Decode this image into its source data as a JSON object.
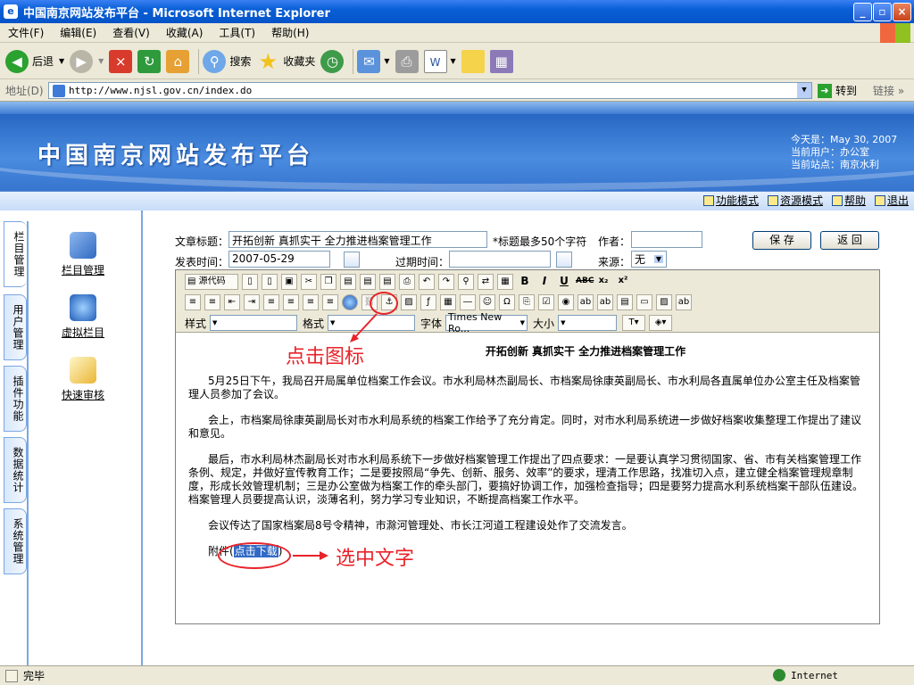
{
  "window": {
    "title": "中国南京网站发布平台 - Microsoft Internet Explorer"
  },
  "menu": [
    "文件(F)",
    "编辑(E)",
    "查看(V)",
    "收藏(A)",
    "工具(T)",
    "帮助(H)"
  ],
  "toolbar": {
    "back": "后退",
    "search": "搜索",
    "favorites": "收藏夹"
  },
  "address": {
    "label": "地址(D)",
    "url": "http://www.njsl.gov.cn/index.do",
    "go": "转到",
    "links": "链接"
  },
  "site": {
    "title": "中国南京网站发布平台",
    "today_label": "今天是：May 30, 2007",
    "user_label": "当前用户：办公室",
    "station_label": "当前站点：南京水利",
    "nav": [
      "功能模式",
      "资源模式",
      "帮助",
      "退出"
    ]
  },
  "sidebar": {
    "tabs": [
      "栏目管理",
      "用户管理",
      "插件功能",
      "数据统计",
      "系统管理"
    ],
    "items": [
      "栏目管理",
      "虚拟栏目",
      "快速审核"
    ]
  },
  "form": {
    "title_label": "文章标题：",
    "title_value": "开拓创新 真抓实干 全力推进档案管理工作",
    "title_hint": "*标题最多50个字符",
    "author_label": "作者：",
    "author_value": "",
    "pubdate_label": "发表时间：",
    "pubdate_value": "2007-05-29",
    "expire_label": "过期时间：",
    "expire_value": "",
    "source_label": "来源：",
    "source_value": "无",
    "save": "保 存",
    "back": "返 回"
  },
  "editor_toolbar": {
    "source_code": "源代码",
    "style_label": "样式",
    "format_label": "格式",
    "font_label": "字体",
    "font_value": "Times New Ro...",
    "size_label": "大小"
  },
  "document": {
    "title": "开拓创新 真抓实干 全力推进档案管理工作",
    "paragraphs": [
      "5月25日下午，我局召开局属单位档案工作会议。市水利局林杰副局长、市档案局徐康英副局长、市水利局各直属单位办公室主任及档案管理人员参加了会议。",
      "会上，市档案局徐康英副局长对市水利局系统的档案工作给予了充分肯定。同时，对市水利局系统进一步做好档案收集整理工作提出了建议和意见。",
      "最后，市水利局林杰副局长对市水利局系统下一步做好档案管理工作提出了四点要求：一是要认真学习贯彻国家、省、市有关档案管理工作条例、规定，并做好宣传教育工作；二是要按照局“争先、创新、服务、效率”的要求，理清工作思路，找准切入点，建立健全档案管理规章制度，形成长效管理机制；三是办公室做为档案工作的牵头部门，要搞好协调工作，加强检查指导；四是要努力提高水利系统档案干部队伍建设。档案管理人员要提高认识，淡薄名利，努力学习专业知识，不断提高档案工作水平。",
      "会议传达了国家档案局8号令精神，市滁河管理处、市长江河道工程建设处作了交流发言。"
    ],
    "attach_prefix": "附件(",
    "attach_link": "点击下载",
    "attach_suffix": ")"
  },
  "annotations": {
    "click_icon": "点击图标",
    "select_text": "选中文字"
  },
  "status": {
    "text": "完毕",
    "zone": "Internet"
  },
  "colors": {
    "banner": "#2E6AC7",
    "selection": "#316AC5",
    "annotation": "#E8232A"
  }
}
